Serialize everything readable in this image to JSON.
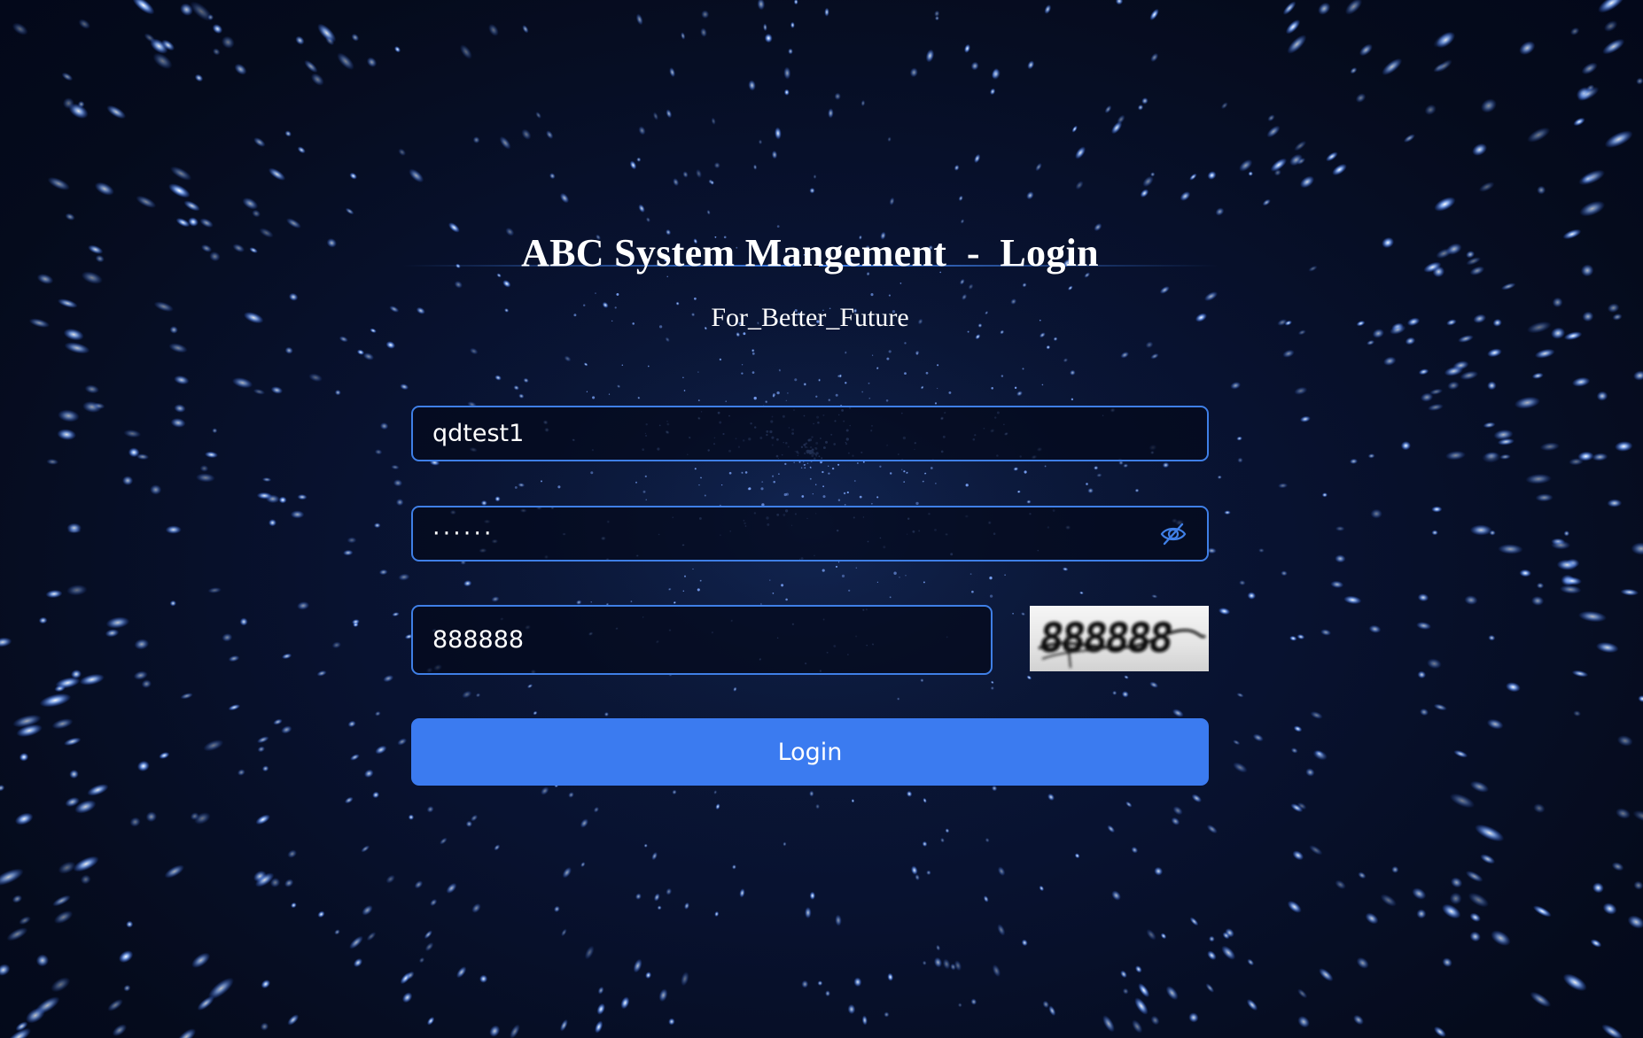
{
  "header": {
    "title": "ABC System Mangement  -  Login",
    "subtitle": "For_Better_Future"
  },
  "form": {
    "username": {
      "value": "qdtest1",
      "icon": "none"
    },
    "password": {
      "value": "······",
      "toggle_icon": "eye-off-icon"
    },
    "captcha": {
      "value": "888888",
      "image_text": "888888"
    },
    "login_label": "Login"
  },
  "colors": {
    "background": "#050b1c",
    "accent": "#3b7bf0",
    "field_border": "#3f7fe6",
    "star": "#5f9bff"
  }
}
